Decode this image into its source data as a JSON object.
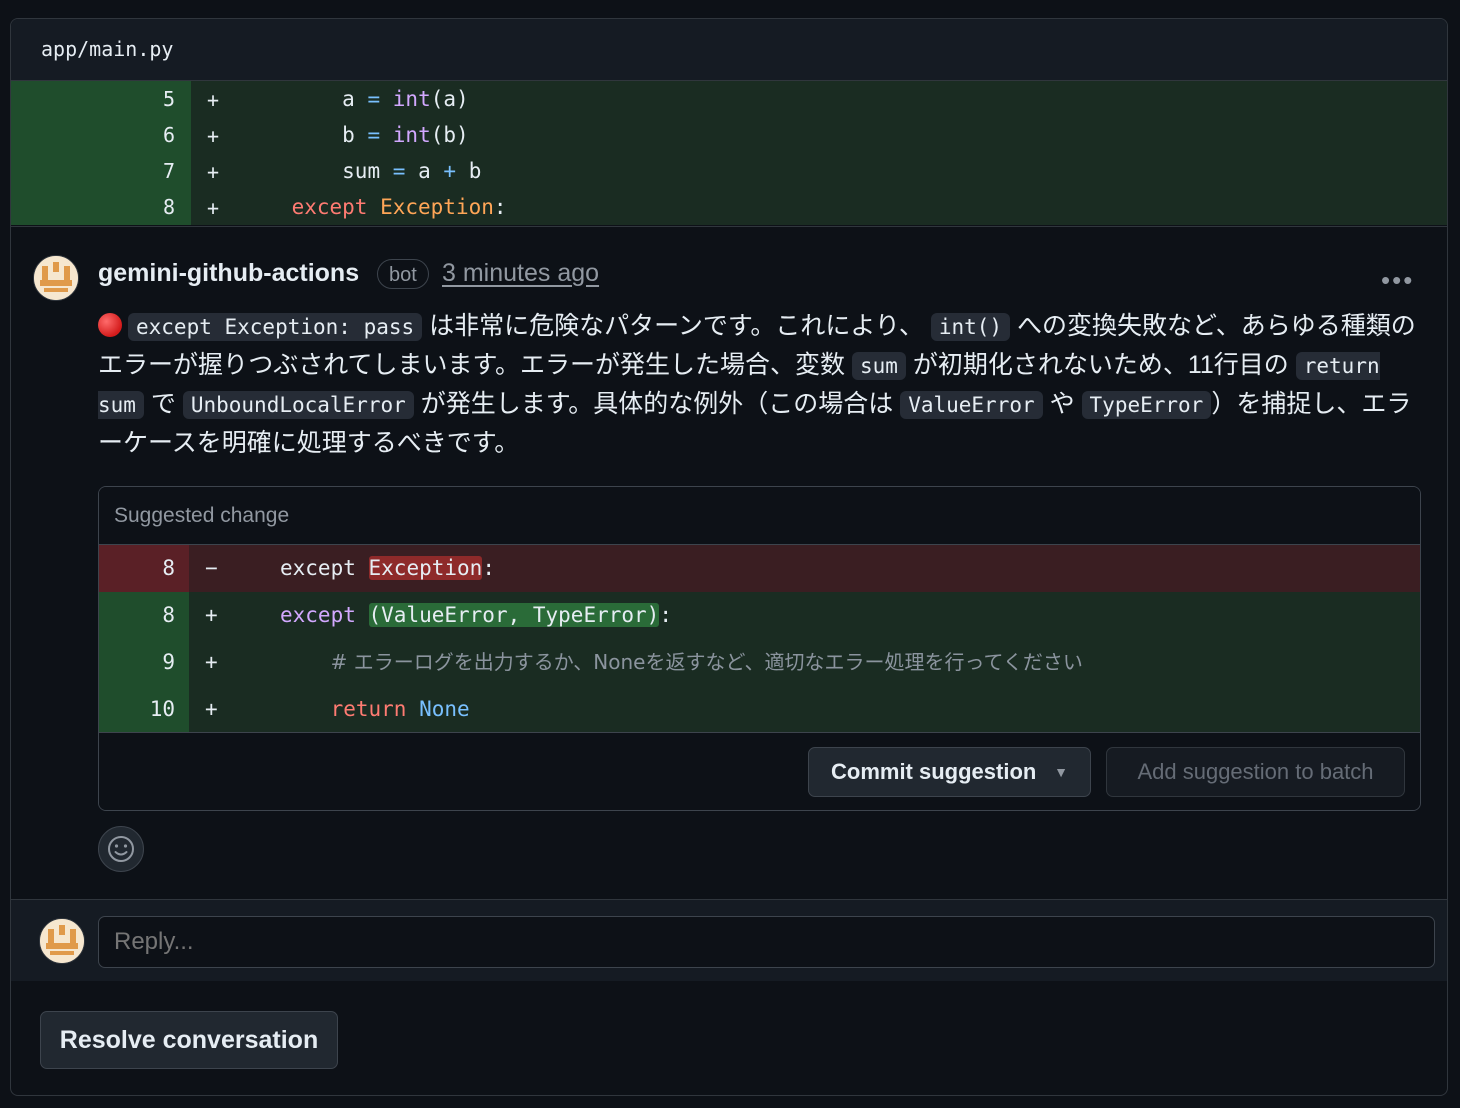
{
  "file": {
    "path": "app/main.py"
  },
  "diff": {
    "lines": [
      {
        "num": "5",
        "sign": "+"
      },
      {
        "num": "6",
        "sign": "+"
      },
      {
        "num": "7",
        "sign": "+"
      },
      {
        "num": "8",
        "sign": "+"
      }
    ],
    "code": {
      "l5_a": "a",
      "l5_eq": "=",
      "l5_fn": "int",
      "l5_arg": "(a)",
      "l6_b": "b",
      "l6_eq": "=",
      "l6_fn": "int",
      "l6_arg": "(b)",
      "l7_sum": "sum",
      "l7_eq": "=",
      "l7_a": "a",
      "l7_plus": "+",
      "l7_b": "b",
      "l8_except": "except",
      "l8_exc": "Exception",
      "l8_colon": ":"
    }
  },
  "comment": {
    "author": "gemini-github-actions",
    "badge": "bot",
    "timestamp": "3 minutes ago",
    "menu": "•••",
    "body": {
      "code1": "except Exception: pass",
      "t1": " は非常に危険なパターンです。これにより、 ",
      "code2": "int()",
      "t2": " への変換失敗など、あらゆる種類のエラーが握りつぶされてしまいます。エラーが発生した場合、変数 ",
      "code3": "sum",
      "t3": " が初期化されないため、11行目の ",
      "code4": "return sum",
      "t4": " で ",
      "code5": "UnboundLocalError",
      "t5": " が発生します。具体的な例外（この場合は ",
      "code6": "ValueError",
      "t6": " や ",
      "code7": "TypeError",
      "t7": "）を捕捉し、エラーケースを明確に処理するべきです。"
    }
  },
  "suggestion": {
    "title": "Suggested change",
    "rows": [
      {
        "num": "8",
        "sign": "−"
      },
      {
        "num": "8",
        "sign": "+"
      },
      {
        "num": "9",
        "sign": "+"
      },
      {
        "num": "10",
        "sign": "+"
      }
    ],
    "code": {
      "del_except": "except ",
      "del_exc": "Exception",
      "del_colon": ":",
      "add_except": "except ",
      "add_tuple": "(ValueError, TypeError)",
      "add_colon": ":",
      "comment": "# エラーログを出力するか、Noneを返すなど、適切なエラー処理を行ってください",
      "ret_kw": "return ",
      "ret_val": "None"
    },
    "commit_label": "Commit suggestion",
    "batch_label": "Add suggestion to batch"
  },
  "reply": {
    "placeholder": "Reply..."
  },
  "resolve_label": "Resolve conversation"
}
